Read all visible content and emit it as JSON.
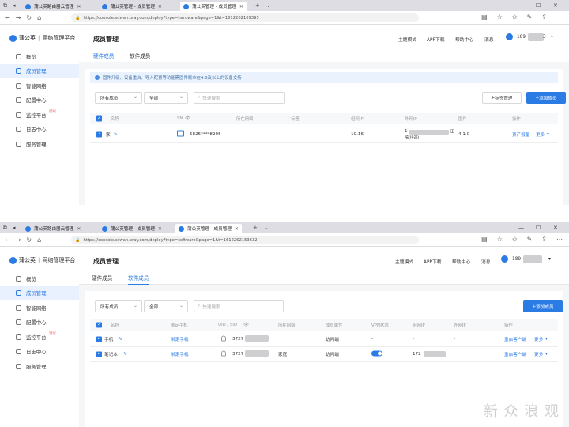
{
  "shot1": {
    "tabs": [
      {
        "label": "蒲公英路由器云管理",
        "active": false
      },
      {
        "label": "蒲公英管理 - 成员管理",
        "active": false
      },
      {
        "label": "蒲公英管理 - 成员管理",
        "active": true
      }
    ],
    "url": "https://console.sdwan.oray.com/deploy?type=hardware&page=1&t=1612262109395",
    "logo": "蒲公英",
    "platform": "网络管理平台",
    "menu": [
      {
        "label": "概览",
        "icon": "overview-icon"
      },
      {
        "label": "成员管理",
        "icon": "members-icon",
        "active": true
      },
      {
        "label": "智能网络",
        "icon": "network-icon"
      },
      {
        "label": "配置中心",
        "icon": "config-icon"
      },
      {
        "label": "监控平台",
        "icon": "monitor-icon",
        "badge": "测试"
      },
      {
        "label": "日志中心",
        "icon": "log-icon"
      },
      {
        "label": "服务管理",
        "icon": "service-icon"
      }
    ],
    "page_title": "成员管理",
    "top_nav": {
      "theme": "主题模式",
      "app": "APP下载",
      "help": "帮助中心",
      "msg": "消息",
      "user": "189",
      "user_tail": "3"
    },
    "subtabs": {
      "hardware": "硬件成员",
      "software": "软件成员"
    },
    "notice": "固件升级、设备重启、导入配置等功能需固件版本在4.6及以上的设备支持",
    "filter_member": "所有成员",
    "filter_all": "全部",
    "search_placeholder": "快速搜索",
    "tag_button": "标签管理",
    "add_button": "添加成员",
    "columns": [
      "名称",
      "SN",
      "所在网络",
      "标签",
      "组网IP",
      "外网IP",
      "固件",
      "操作"
    ],
    "rows": [
      {
        "name": "家",
        "sn": "5825****8205",
        "network": "-",
        "tag": "-",
        "lan_ip": "10.16",
        "wan_ip": "1",
        "wan_ip_tail": "江",
        "wan_ip_sub": "暗(IP调)",
        "firmware": "4.1.0",
        "action1": "资产报备",
        "action2": "更多"
      }
    ]
  },
  "shot2": {
    "tabs": [
      {
        "label": "蒲公英路由器云管理",
        "active": false
      },
      {
        "label": "蒲公英管理 - 成员管理",
        "active": false
      },
      {
        "label": "蒲公英管理 - 成员管理",
        "active": true
      }
    ],
    "url": "https://console.sdwan.oray.com/deploy?type=software&page=1&t=1612262153632",
    "logo": "蒲公英",
    "platform": "网络管理平台",
    "menu": [
      {
        "label": "概览",
        "icon": "overview-icon"
      },
      {
        "label": "成员管理",
        "icon": "members-icon",
        "active": true
      },
      {
        "label": "智能网络",
        "icon": "network-icon"
      },
      {
        "label": "配置中心",
        "icon": "config-icon"
      },
      {
        "label": "监控平台",
        "icon": "monitor-icon",
        "badge": "测试"
      },
      {
        "label": "日志中心",
        "icon": "log-icon"
      },
      {
        "label": "服务管理",
        "icon": "service-icon"
      }
    ],
    "page_title": "成员管理",
    "top_nav": {
      "theme": "主题模式",
      "app": "APP下载",
      "help": "帮助中心",
      "msg": "消息",
      "user": "189"
    },
    "subtabs": {
      "hardware": "硬件成员",
      "software": "软件成员"
    },
    "filter_member": "所有成员",
    "filter_all": "全部",
    "search_placeholder": "快速搜索",
    "add_button": "添加成员",
    "columns": [
      "名称",
      "绑定手机",
      "UID / SID",
      "所在网络",
      "成员属性",
      "VPN状态",
      "组网IP",
      "外网IP",
      "操作"
    ],
    "rows": [
      {
        "name": "手机",
        "phone": "绑定手机",
        "uid": "3727",
        "network": "",
        "attr": "访问端",
        "vpn": "-",
        "lan_ip": "-",
        "wan_ip": "-",
        "action1": "重启客户端",
        "action2": "更多"
      },
      {
        "name": "笔记本",
        "phone": "绑定手机",
        "uid": "3727",
        "network": "家庭",
        "attr": "访问端",
        "vpn": "on",
        "lan_ip": "172",
        "wan_ip": "",
        "action1": "重启客户端",
        "action2": "更多"
      }
    ]
  },
  "watermark": "新 众 浪 观",
  "colors": {
    "accent": "#2b7be4",
    "sidebar_active_bg": "#e8f1fd",
    "tabbar": "#dedde4"
  }
}
